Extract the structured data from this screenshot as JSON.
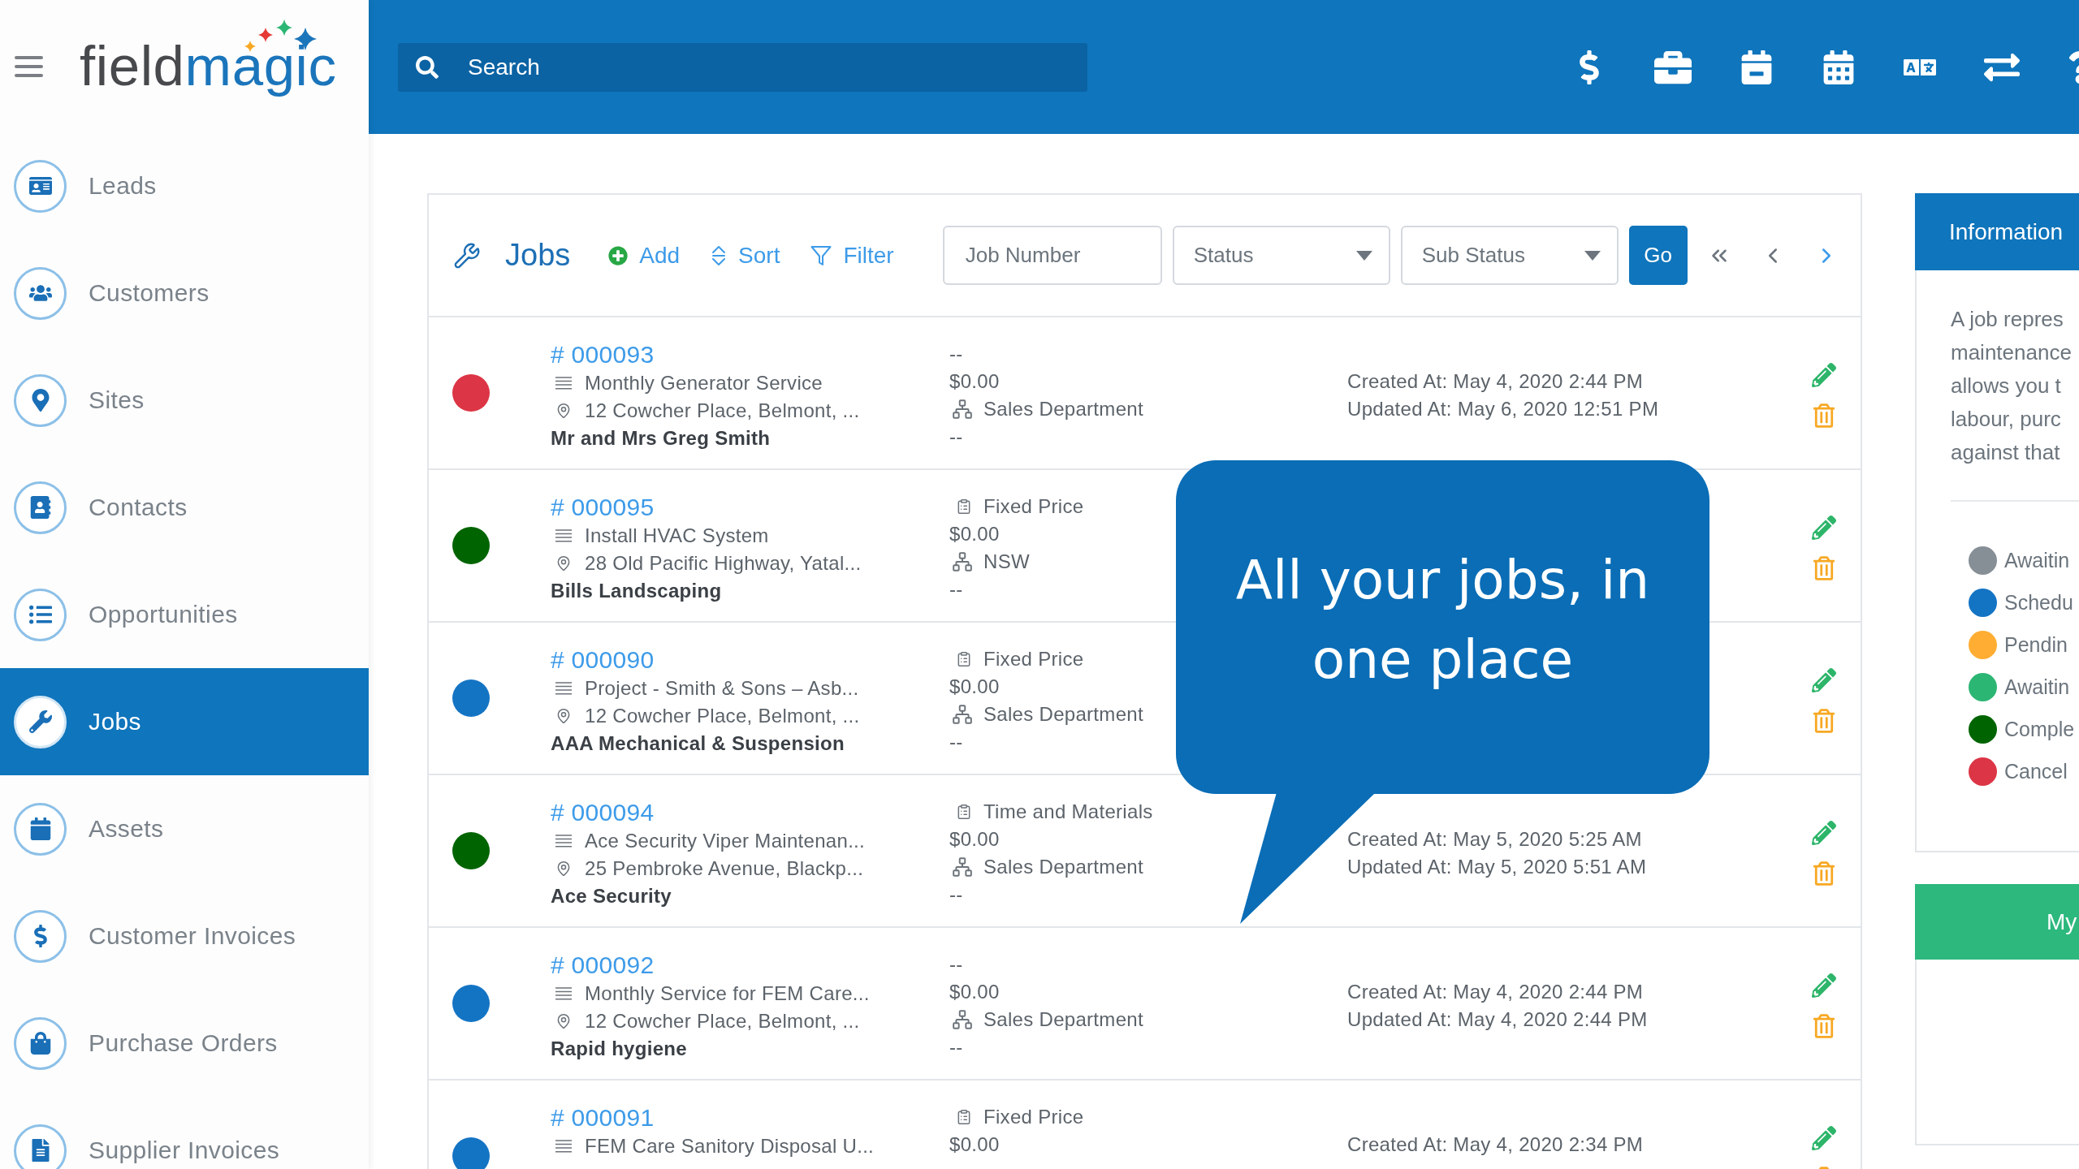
{
  "sidebar": {
    "logo": {
      "first_part": "field",
      "second_part": "magic"
    },
    "items": [
      {
        "label": "Leads",
        "selected": false
      },
      {
        "label": "Customers",
        "selected": false
      },
      {
        "label": "Sites",
        "selected": false
      },
      {
        "label": "Contacts",
        "selected": false
      },
      {
        "label": "Opportunities",
        "selected": false
      },
      {
        "label": "Jobs",
        "selected": true
      },
      {
        "label": "Assets",
        "selected": false
      },
      {
        "label": "Customer Invoices",
        "selected": false
      },
      {
        "label": "Purchase Orders",
        "selected": false
      },
      {
        "label": "Supplier Invoices",
        "selected": false
      }
    ]
  },
  "header": {
    "search": {
      "placeholder": "Search"
    }
  },
  "jobs_panel": {
    "title": "Jobs",
    "actions": [
      {
        "kind": "add",
        "label": "Add"
      },
      {
        "kind": "sort",
        "label": "Sort"
      },
      {
        "kind": "filter",
        "label": "Filter"
      }
    ],
    "job_number": {
      "placeholder": "Job Number"
    },
    "status": {
      "placeholder": "Status"
    },
    "sub_status": {
      "placeholder": "Sub Status"
    },
    "go_button": "Go",
    "pagination": [
      {
        "kind": "first",
        "disabled": true
      },
      {
        "kind": "previous",
        "disabled": true
      },
      {
        "kind": "next",
        "disabled": false
      }
    ],
    "jobs": [
      {
        "number": "# 000093",
        "color": "#dc3545",
        "description": "Monthly Generator Service",
        "address": "12 Cowcher Place, Belmont, ...",
        "customer": "Mr and Mrs Greg Smith",
        "pricing": {
          "kind": "none",
          "text": "--"
        },
        "amount": "$0.00",
        "department": "Sales Department",
        "notes": "--",
        "created": "Created At: May 4, 2020 2:44 PM",
        "updated": "Updated At: May 6, 2020 12:51 PM"
      },
      {
        "number": "# 000095",
        "color": "#006400",
        "description": "Install HVAC System",
        "address": "28 Old Pacific Highway, Yatal...",
        "customer": "Bills Landscaping",
        "pricing": {
          "kind": "type",
          "text": "Fixed Price"
        },
        "amount": "$0.00",
        "department": "NSW",
        "notes": "--"
      },
      {
        "number": "# 000090",
        "color": "#1474c4",
        "description": "Project - Smith & Sons – Asb...",
        "address": "12 Cowcher Place, Belmont, ...",
        "customer": "AAA Mechanical & Suspension",
        "pricing": {
          "kind": "type",
          "text": "Fixed Price"
        },
        "amount": "$0.00",
        "department": "Sales Department",
        "notes": "--"
      },
      {
        "number": "# 000094",
        "color": "#006400",
        "description": "Ace Security Viper Maintenan...",
        "address": "25 Pembroke Avenue, Blackp...",
        "customer": "Ace Security",
        "pricing": {
          "kind": "type",
          "text": "Time and Materials"
        },
        "amount": "$0.00",
        "department": "Sales Department",
        "notes": "--",
        "created": "Created At: May 5, 2020 5:25 AM",
        "updated": "Updated At: May 5, 2020 5:51 AM"
      },
      {
        "number": "# 000092",
        "color": "#1474c4",
        "description": "Monthly Service for FEM Care...",
        "address": "12 Cowcher Place, Belmont, ...",
        "customer": "Rapid hygiene",
        "pricing": {
          "kind": "none",
          "text": "--"
        },
        "amount": "$0.00",
        "department": "Sales Department",
        "notes": "--",
        "created": "Created At: May 4, 2020 2:44 PM",
        "updated": "Updated At: May 4, 2020 2:44 PM"
      },
      {
        "number": "# 000091",
        "color": "#1474c4",
        "description": "FEM Care Sanitory Disposal U...",
        "pricing": {
          "kind": "type",
          "text": "Fixed Price"
        },
        "amount": "$0.00",
        "created": "Created At: May 4, 2020 2:34 PM"
      }
    ]
  },
  "callout": {
    "lines": [
      "All your jobs, in",
      "one place"
    ]
  },
  "information": {
    "title": "Information",
    "text_lines": [
      "A job repres",
      "maintenance",
      "allows you t",
      "labour, purc",
      "against that"
    ],
    "legend": [
      {
        "label": "Awaitin",
        "color": "#868e96"
      },
      {
        "label": "Schedu",
        "color": "#1474c4"
      },
      {
        "label": "Pendin",
        "color": "#ffad33"
      },
      {
        "label": "Awaitin",
        "color": "#2bb673"
      },
      {
        "label": "Comple",
        "color": "#006400"
      },
      {
        "label": "Cancel",
        "color": "#dc3545"
      }
    ]
  },
  "my_card": {
    "title": "My"
  }
}
